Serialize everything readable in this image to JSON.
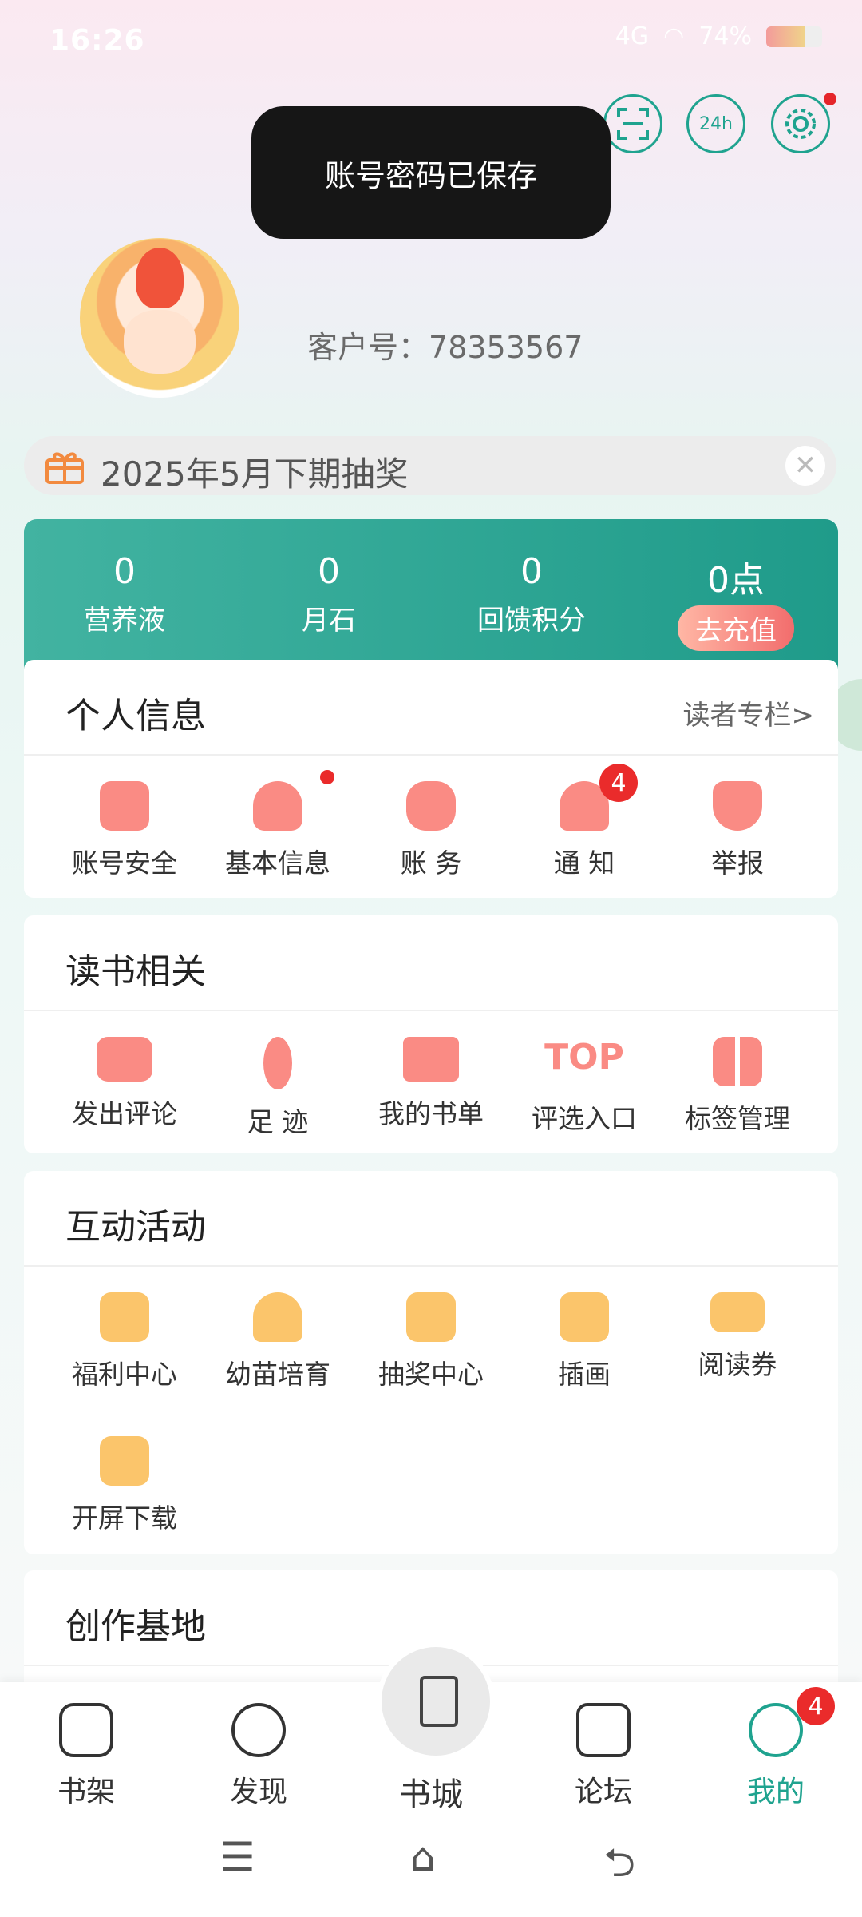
{
  "status_bar": {
    "time": "16:26",
    "battery": "74%",
    "network": "4G"
  },
  "header_icons": [
    "scan-icon",
    "headset-24h-icon",
    "settings-icon"
  ],
  "toast": "账号密码已保存",
  "profile": {
    "customer_label": "客户号：",
    "customer_id": "78353567"
  },
  "banner": {
    "text": "2025年5月下期抽奖"
  },
  "stats": [
    {
      "value": "0",
      "label": "营养液"
    },
    {
      "value": "0",
      "label": "月石"
    },
    {
      "value": "0",
      "label": "回馈积分"
    },
    {
      "value": "0点",
      "label": "去充值"
    }
  ],
  "personal": {
    "title": "个人信息",
    "more": "读者专栏>",
    "items": [
      "账号安全",
      "基本信息",
      "账  务",
      "通  知",
      "举报"
    ],
    "notify_badge": "4"
  },
  "reading": {
    "title": "读书相关",
    "items": [
      "发出评论",
      "足  迹",
      "我的书单",
      "评选入口",
      "标签管理"
    ]
  },
  "activity": {
    "title": "互动活动",
    "items": [
      "福利中心",
      "幼苗培育",
      "抽奖中心",
      "插画",
      "阅读券",
      "开屏下载"
    ]
  },
  "creation": {
    "title": "创作基地"
  },
  "nav": {
    "items": [
      "书架",
      "发现",
      "书城",
      "论坛",
      "我的"
    ],
    "mine_badge": "4",
    "active_color": "#1fa38f"
  }
}
